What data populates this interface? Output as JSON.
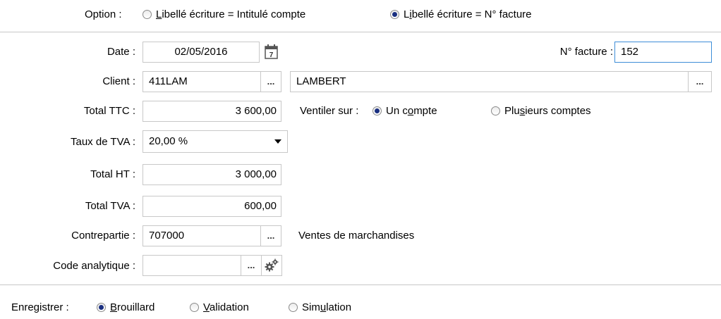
{
  "option": {
    "label": "Option :",
    "choice1_pre": "",
    "choice1_u": "L",
    "choice1_post": "ibellé écriture = Intitulé compte",
    "choice2_pre": "L",
    "choice2_u": "i",
    "choice2_post": "bellé écriture = N° facture",
    "selected": 2
  },
  "form": {
    "date_label": "Date :",
    "date_value": "02/05/2016",
    "invoice_label": "N° facture :",
    "invoice_value": "152",
    "client_label": "Client :",
    "client_code": "411LAM",
    "client_name": "LAMBERT",
    "total_ttc_label": "Total TTC :",
    "total_ttc_value": "3 600,00",
    "ventiler_label": "Ventiler sur :",
    "ventiler_opt1_pre": "Un c",
    "ventiler_opt1_u": "o",
    "ventiler_opt1_post": "mpte",
    "ventiler_opt2_pre": "Plu",
    "ventiler_opt2_u": "s",
    "ventiler_opt2_post": "ieurs comptes",
    "ventiler_selected": 1,
    "tva_rate_label": "Taux de TVA :",
    "tva_rate_value": "20,00 %",
    "total_ht_label": "Total HT :",
    "total_ht_value": "3 000,00",
    "total_tva_label": "Total TVA :",
    "total_tva_value": "600,00",
    "contrepartie_label": "Contrepartie :",
    "contrepartie_value": "707000",
    "contrepartie_desc": "Ventes de marchandises",
    "analytique_label": "Code analytique :",
    "analytique_value": "",
    "ellipsis": "..."
  },
  "save": {
    "label": "Enregistrer :",
    "opt1_pre": "",
    "opt1_u": "B",
    "opt1_post": "rouillard",
    "opt2_pre": "",
    "opt2_u": "V",
    "opt2_post": "alidation",
    "opt3_pre": "Sim",
    "opt3_u": "u",
    "opt3_post": "lation",
    "selected": 1
  }
}
